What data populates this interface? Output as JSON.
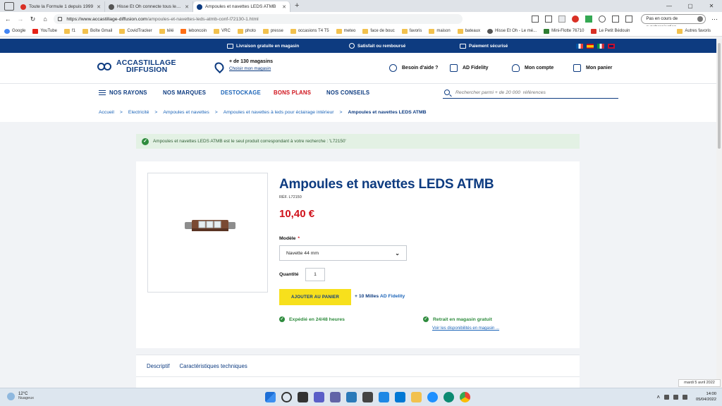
{
  "browser": {
    "tabs": [
      {
        "title": "Toute la Formule 1 depuis 1999",
        "color": "#d93025"
      },
      {
        "title": "Hisse Et Oh connecte tous les ja",
        "color": "#555555"
      },
      {
        "title": "Ampoules et navettes LEDS ATMB",
        "color": "#0d3b80",
        "active": true
      }
    ],
    "url_host": "https://www.accastillage-diffusion.com",
    "url_path": "/ampoules-et-navettes-leds-atmb-conf-l72130-1.html",
    "sync_label": "Pas en cours de synchronisation",
    "bookmarks": [
      {
        "label": "Google",
        "icon": "google-icon"
      },
      {
        "label": "YouTube",
        "icon": "youtube-icon"
      },
      {
        "label": "f1",
        "icon": "folder-icon"
      },
      {
        "label": "Boîte Gmail",
        "icon": "folder-icon"
      },
      {
        "label": "CovidTracker",
        "icon": "folder-icon"
      },
      {
        "label": "télé",
        "icon": "folder-icon"
      },
      {
        "label": "leboncoin",
        "icon": "leboncoin-icon"
      },
      {
        "label": "VRC",
        "icon": "folder-icon"
      },
      {
        "label": "photo",
        "icon": "folder-icon"
      },
      {
        "label": "presse",
        "icon": "folder-icon"
      },
      {
        "label": "occasions T4 T5",
        "icon": "folder-icon"
      },
      {
        "label": "meteo",
        "icon": "folder-icon"
      },
      {
        "label": "face de bouc",
        "icon": "folder-icon"
      },
      {
        "label": "favoris",
        "icon": "folder-icon"
      },
      {
        "label": "maison",
        "icon": "folder-icon"
      },
      {
        "label": "bateaux",
        "icon": "folder-icon"
      },
      {
        "label": "Hisse Et Oh - Le mé...",
        "icon": "hisse-icon"
      },
      {
        "label": "Mini-Flotte 76710",
        "icon": "flotte-icon"
      },
      {
        "label": "Le Petit Bédouin",
        "icon": "bedouin-icon"
      }
    ],
    "other_favorites": "Autres favoris"
  },
  "site": {
    "strip": {
      "delivery": "Livraison gratuite en magasin",
      "satisfied": "Satisfait ou remboursé",
      "payment": "Paiement sécurisé"
    },
    "logo_line1": "ACCASTILLAGE",
    "logo_line2": "DIFFUSION",
    "stores_count": "+ de 130 magasins",
    "stores_link": "Choisir mon magasin",
    "help": "Besoin d'aide ?",
    "fidelity": "AD Fidelity",
    "account": "Mon compte",
    "cart": "Mon panier",
    "nav": {
      "rayons": "NOS RAYONS",
      "marques": "NOS MARQUES",
      "destockage": "DESTOCKAGE",
      "bons_plans": "BONS PLANS",
      "conseils": "NOS CONSEILS"
    },
    "search_placeholder": "Rechercher parmi + de 20 000  références",
    "breadcrumb": [
      "Accueil",
      "Electricité",
      "Ampoules et navettes",
      "Ampoules et navettes à leds pour éclairage intérieur",
      "Ampoules et navettes LEDS ATMB"
    ]
  },
  "alert": "Ampoules et navettes LEDS ATMB est le seul produit correspondant à votre recherche : 'L72150'",
  "product": {
    "title": "Ampoules et navettes LEDS ATMB",
    "ref": "RÉF. L72150",
    "price": "10,40 €",
    "model_label": "Modèle",
    "model_required": "*",
    "model_value": "Navette 44 mm",
    "qty_label": "Quantité",
    "qty_value": "1",
    "add_to_cart": "AJOUTER AU PANIER",
    "miles": "+ 10 Milles",
    "miles_program": "AD Fidelity",
    "shipping": "Expédié en 24/48 heures",
    "pickup": "Retrait en magasin gratuit",
    "availability_link": "Voir les disponibilités en magasin ..."
  },
  "product_tabs": [
    "Descriptif",
    "Caractéristiques techniques"
  ],
  "toast": "mardi 5 avril 2022",
  "taskbar": {
    "temp": "12°C",
    "weather": "Nuageux",
    "time": "14:00",
    "date": "05/04/2022"
  },
  "colors": {
    "brand_blue": "#0d3b80",
    "price_red": "#d0121b",
    "cta_yellow": "#f7e01c",
    "success_green": "#2e8b3d"
  }
}
